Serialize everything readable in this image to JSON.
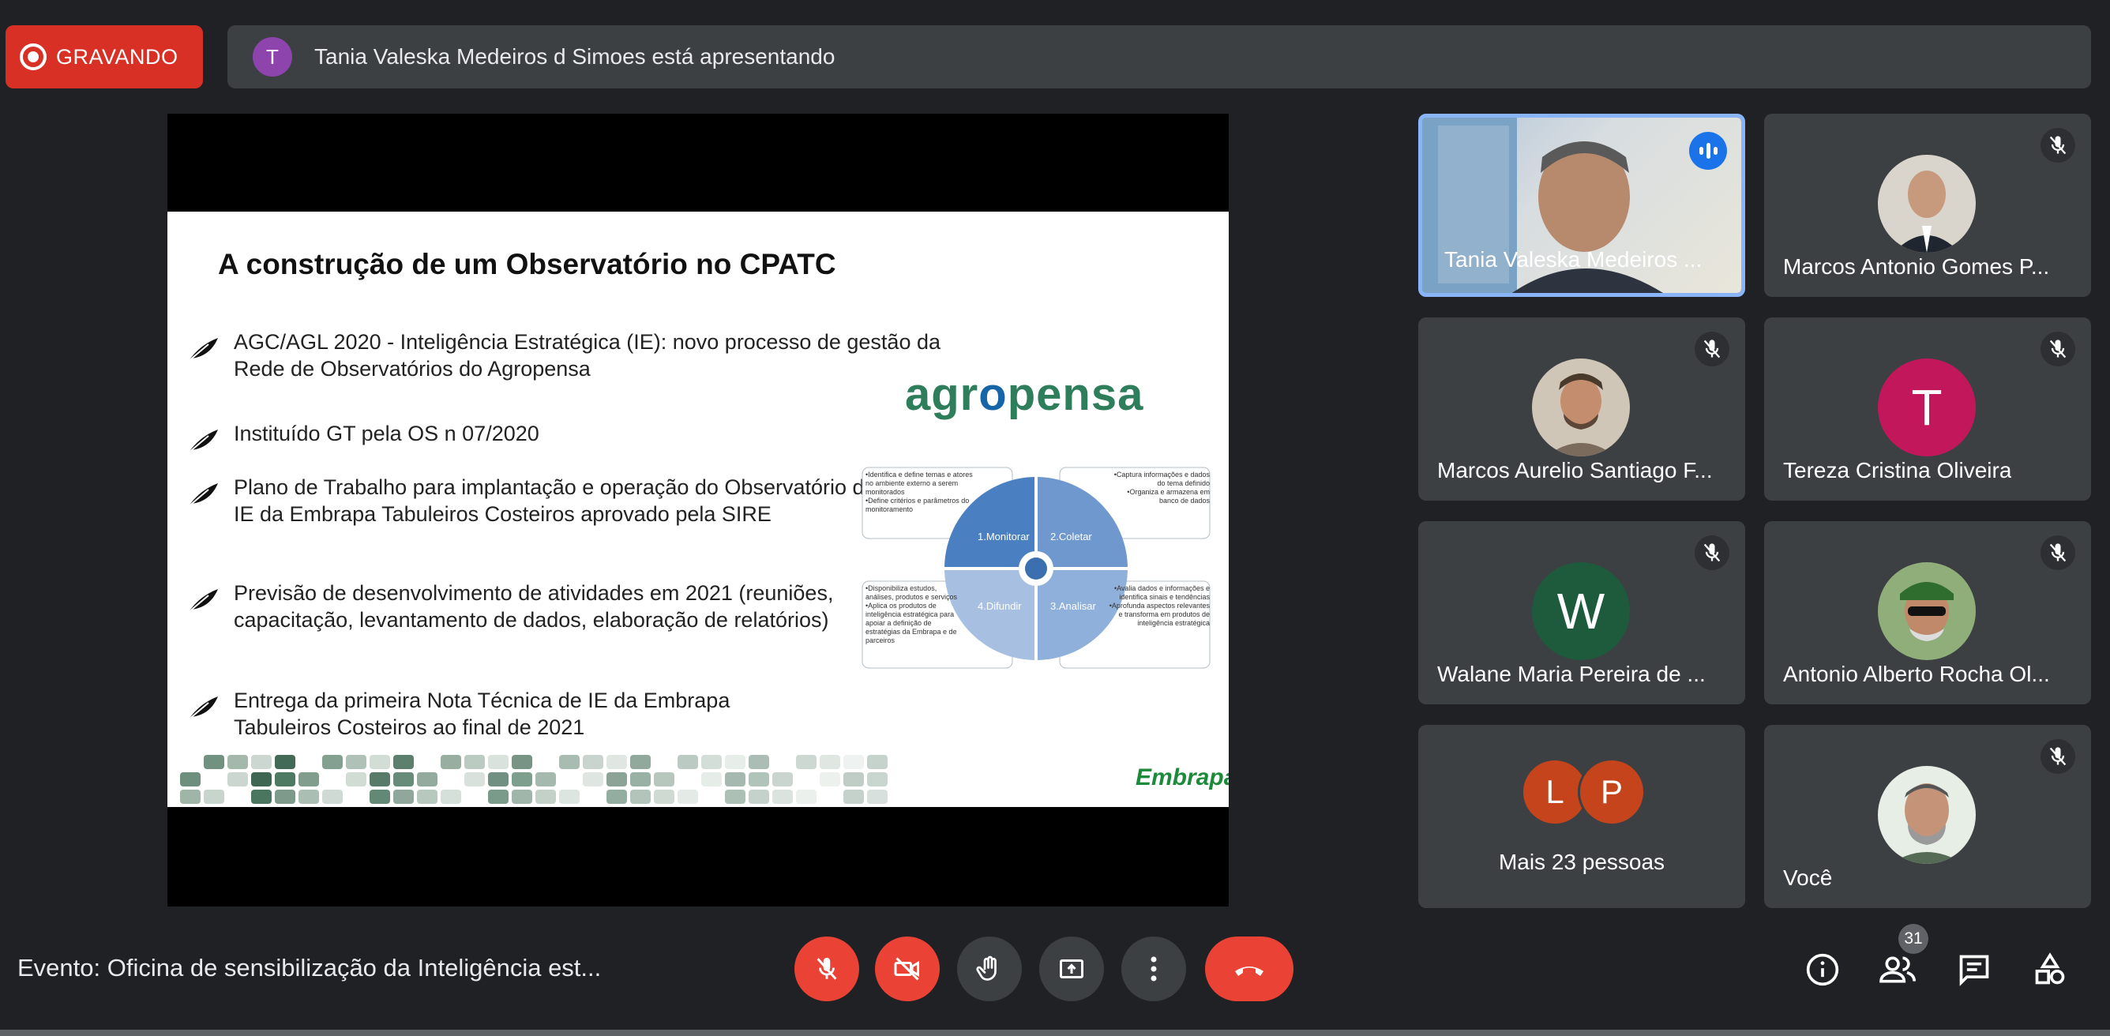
{
  "recording": {
    "label": "GRAVANDO",
    "color": "#d93025"
  },
  "presenting": {
    "avatar_letter": "T",
    "text": "Tania Valeska Medeiros d Simoes está apresentando"
  },
  "slide": {
    "title": "A construção de um Observatório no CPATC",
    "bullets": [
      "AGC/AGL 2020 - Inteligência Estratégica (IE): novo processo de gestão da Rede de Observatórios do Agropensa",
      "Instituído GT pela OS n 07/2020",
      "Plano de Trabalho para implantação e operação do Observatório de IE da Embrapa Tabuleiros Costeiros aprovado pela SIRE",
      "Previsão de desenvolvimento de atividades em 2021 (reuniões, capacitação, levantamento de dados, elaboração de relatórios)",
      "Entrega da primeira Nota Técnica de IE da Embrapa Tabuleiros Costeiros ao final de 2021"
    ],
    "logo_left": "agr",
    "logo_mid": "o",
    "logo_right": "pensa",
    "cycle": {
      "q1": "1.Monitorar",
      "q2": "2.Coletar",
      "q3": "3.Analisar",
      "q4": "4.Difundir",
      "box_tl_a": "•Identifica e define temas e atores no ambiente externo a serem monitorados",
      "box_tl_b": "•Define critérios e parâmetros do monitoramento",
      "box_tr_a": "•Captura informações e dados do tema definido",
      "box_tr_b": "•Organiza e armazena em banco de dados",
      "box_bl_a": "•Disponibiliza estudos, análises, produtos e serviços",
      "box_bl_b": "•Aplica os produtos de inteligência estratégica para apoiar a definição de estratégias da Embrapa e de parceiros",
      "box_br_a": "•Avalia dados e informações e identifica sinais e tendências",
      "box_br_b": "•Aprofunda aspectos relevantes e transforma em produtos de inteligência estratégica"
    },
    "footer_logo": "Embrapa"
  },
  "participants": [
    {
      "name": "Tania Valeska Medeiros ...",
      "type": "video",
      "speaking": true
    },
    {
      "name": "Marcos Antonio Gomes P...",
      "type": "photo",
      "muted": true
    },
    {
      "name": "Marcos Aurelio Santiago F...",
      "type": "photo",
      "muted": true
    },
    {
      "name": "Tereza Cristina Oliveira",
      "type": "letter",
      "letter": "T",
      "color": "#c2185b",
      "muted": true
    },
    {
      "name": "Walane Maria Pereira de ...",
      "type": "letter",
      "letter": "W",
      "color": "#1e5a3c",
      "muted": true
    },
    {
      "name": "Antonio Alberto Rocha Ol...",
      "type": "photo",
      "muted": true
    },
    {
      "name": "Mais 23 pessoas",
      "type": "group",
      "letters": [
        "L",
        "P"
      ]
    },
    {
      "name": "Você",
      "type": "photo",
      "muted": true
    }
  ],
  "bottom": {
    "meeting_title": "Evento: Oficina de sensibilização da Inteligência est...",
    "participant_count": "31"
  },
  "icons": {
    "mic": "mic-off-icon",
    "cam": "videocam-off-icon",
    "hand": "raise-hand-icon",
    "present": "present-screen-icon",
    "more": "more-vert-icon",
    "end": "call-end-icon",
    "info": "info-icon",
    "people": "people-icon",
    "chat": "chat-icon",
    "activities": "activities-icon"
  }
}
